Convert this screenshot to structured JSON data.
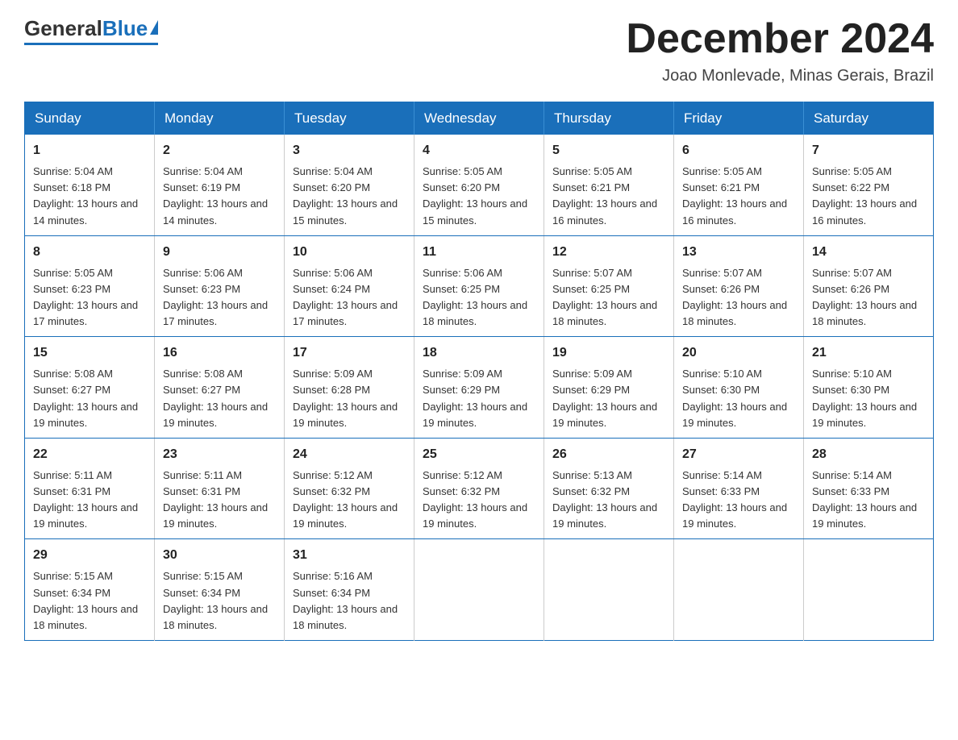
{
  "logo": {
    "general": "General",
    "blue": "Blue"
  },
  "title": "December 2024",
  "subtitle": "Joao Monlevade, Minas Gerais, Brazil",
  "weekdays": [
    "Sunday",
    "Monday",
    "Tuesday",
    "Wednesday",
    "Thursday",
    "Friday",
    "Saturday"
  ],
  "weeks": [
    [
      {
        "day": "1",
        "sunrise": "5:04 AM",
        "sunset": "6:18 PM",
        "daylight": "13 hours and 14 minutes."
      },
      {
        "day": "2",
        "sunrise": "5:04 AM",
        "sunset": "6:19 PM",
        "daylight": "13 hours and 14 minutes."
      },
      {
        "day": "3",
        "sunrise": "5:04 AM",
        "sunset": "6:20 PM",
        "daylight": "13 hours and 15 minutes."
      },
      {
        "day": "4",
        "sunrise": "5:05 AM",
        "sunset": "6:20 PM",
        "daylight": "13 hours and 15 minutes."
      },
      {
        "day": "5",
        "sunrise": "5:05 AM",
        "sunset": "6:21 PM",
        "daylight": "13 hours and 16 minutes."
      },
      {
        "day": "6",
        "sunrise": "5:05 AM",
        "sunset": "6:21 PM",
        "daylight": "13 hours and 16 minutes."
      },
      {
        "day": "7",
        "sunrise": "5:05 AM",
        "sunset": "6:22 PM",
        "daylight": "13 hours and 16 minutes."
      }
    ],
    [
      {
        "day": "8",
        "sunrise": "5:05 AM",
        "sunset": "6:23 PM",
        "daylight": "13 hours and 17 minutes."
      },
      {
        "day": "9",
        "sunrise": "5:06 AM",
        "sunset": "6:23 PM",
        "daylight": "13 hours and 17 minutes."
      },
      {
        "day": "10",
        "sunrise": "5:06 AM",
        "sunset": "6:24 PM",
        "daylight": "13 hours and 17 minutes."
      },
      {
        "day": "11",
        "sunrise": "5:06 AM",
        "sunset": "6:25 PM",
        "daylight": "13 hours and 18 minutes."
      },
      {
        "day": "12",
        "sunrise": "5:07 AM",
        "sunset": "6:25 PM",
        "daylight": "13 hours and 18 minutes."
      },
      {
        "day": "13",
        "sunrise": "5:07 AM",
        "sunset": "6:26 PM",
        "daylight": "13 hours and 18 minutes."
      },
      {
        "day": "14",
        "sunrise": "5:07 AM",
        "sunset": "6:26 PM",
        "daylight": "13 hours and 18 minutes."
      }
    ],
    [
      {
        "day": "15",
        "sunrise": "5:08 AM",
        "sunset": "6:27 PM",
        "daylight": "13 hours and 19 minutes."
      },
      {
        "day": "16",
        "sunrise": "5:08 AM",
        "sunset": "6:27 PM",
        "daylight": "13 hours and 19 minutes."
      },
      {
        "day": "17",
        "sunrise": "5:09 AM",
        "sunset": "6:28 PM",
        "daylight": "13 hours and 19 minutes."
      },
      {
        "day": "18",
        "sunrise": "5:09 AM",
        "sunset": "6:29 PM",
        "daylight": "13 hours and 19 minutes."
      },
      {
        "day": "19",
        "sunrise": "5:09 AM",
        "sunset": "6:29 PM",
        "daylight": "13 hours and 19 minutes."
      },
      {
        "day": "20",
        "sunrise": "5:10 AM",
        "sunset": "6:30 PM",
        "daylight": "13 hours and 19 minutes."
      },
      {
        "day": "21",
        "sunrise": "5:10 AM",
        "sunset": "6:30 PM",
        "daylight": "13 hours and 19 minutes."
      }
    ],
    [
      {
        "day": "22",
        "sunrise": "5:11 AM",
        "sunset": "6:31 PM",
        "daylight": "13 hours and 19 minutes."
      },
      {
        "day": "23",
        "sunrise": "5:11 AM",
        "sunset": "6:31 PM",
        "daylight": "13 hours and 19 minutes."
      },
      {
        "day": "24",
        "sunrise": "5:12 AM",
        "sunset": "6:32 PM",
        "daylight": "13 hours and 19 minutes."
      },
      {
        "day": "25",
        "sunrise": "5:12 AM",
        "sunset": "6:32 PM",
        "daylight": "13 hours and 19 minutes."
      },
      {
        "day": "26",
        "sunrise": "5:13 AM",
        "sunset": "6:32 PM",
        "daylight": "13 hours and 19 minutes."
      },
      {
        "day": "27",
        "sunrise": "5:14 AM",
        "sunset": "6:33 PM",
        "daylight": "13 hours and 19 minutes."
      },
      {
        "day": "28",
        "sunrise": "5:14 AM",
        "sunset": "6:33 PM",
        "daylight": "13 hours and 19 minutes."
      }
    ],
    [
      {
        "day": "29",
        "sunrise": "5:15 AM",
        "sunset": "6:34 PM",
        "daylight": "13 hours and 18 minutes."
      },
      {
        "day": "30",
        "sunrise": "5:15 AM",
        "sunset": "6:34 PM",
        "daylight": "13 hours and 18 minutes."
      },
      {
        "day": "31",
        "sunrise": "5:16 AM",
        "sunset": "6:34 PM",
        "daylight": "13 hours and 18 minutes."
      },
      null,
      null,
      null,
      null
    ]
  ]
}
